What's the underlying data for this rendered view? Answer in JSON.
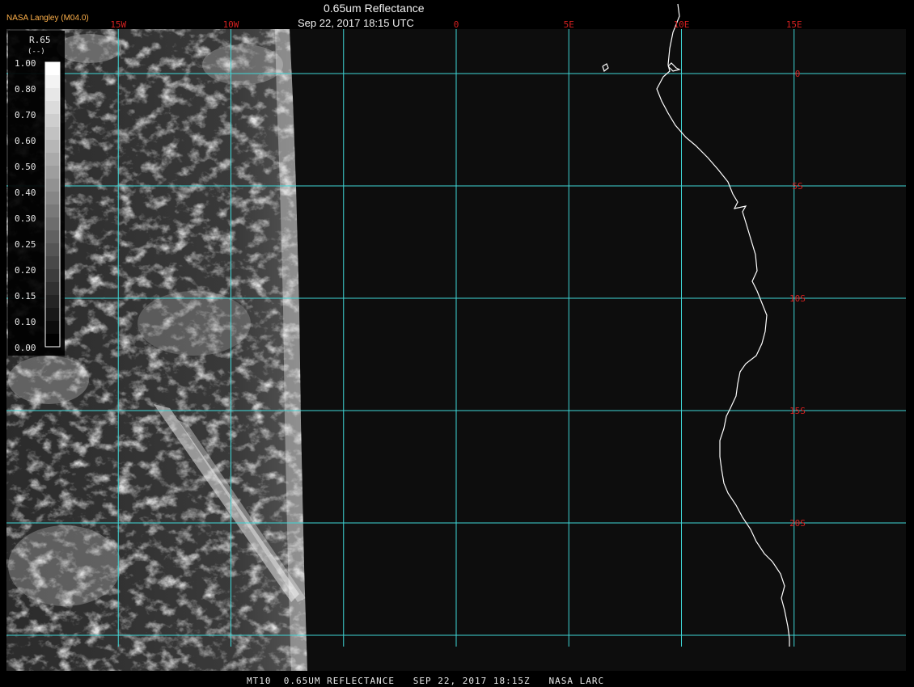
{
  "header": {
    "agency": "NASA Langley (M04.0)",
    "title": "0.65um Reflectance",
    "datetime": "Sep 22, 2017 18:15 UTC"
  },
  "footer": {
    "caption": "MT10  0.65UM REFLECTANCE   SEP 22, 2017 18:15Z   NASA LARC"
  },
  "map": {
    "lon_range": [
      -20,
      15
    ],
    "lat_range": [
      -25,
      2
    ],
    "lon_lines": [
      -15,
      -10,
      -5,
      0,
      5,
      10,
      15
    ],
    "lat_lines": [
      0,
      -5,
      -10,
      -15,
      -20,
      -25
    ],
    "lon_labels": [
      {
        "lon": -15,
        "text": "15W"
      },
      {
        "lon": -10,
        "text": "10W"
      },
      {
        "lon": 0,
        "text": "0"
      },
      {
        "lon": 5,
        "text": "5E"
      },
      {
        "lon": 10,
        "text": "10E"
      },
      {
        "lon": 15,
        "text": "15E"
      }
    ],
    "lat_labels": [
      {
        "lat": 0,
        "text": "0"
      },
      {
        "lat": -5,
        "text": "5S"
      },
      {
        "lat": -10,
        "text": "10S"
      },
      {
        "lat": -15,
        "text": "15S"
      },
      {
        "lat": -20,
        "text": "20S"
      }
    ],
    "colors": {
      "grid": "#3fd6d6",
      "labels": "#d42020",
      "coast": "#ffffff",
      "space": "#0d0d0d"
    }
  },
  "legend": {
    "label": "R.65",
    "units": "(--)",
    "ticks": [
      "1.00",
      "0.80",
      "0.70",
      "0.60",
      "0.50",
      "0.40",
      "0.30",
      "0.25",
      "0.20",
      "0.15",
      "0.10",
      "0.00"
    ]
  }
}
